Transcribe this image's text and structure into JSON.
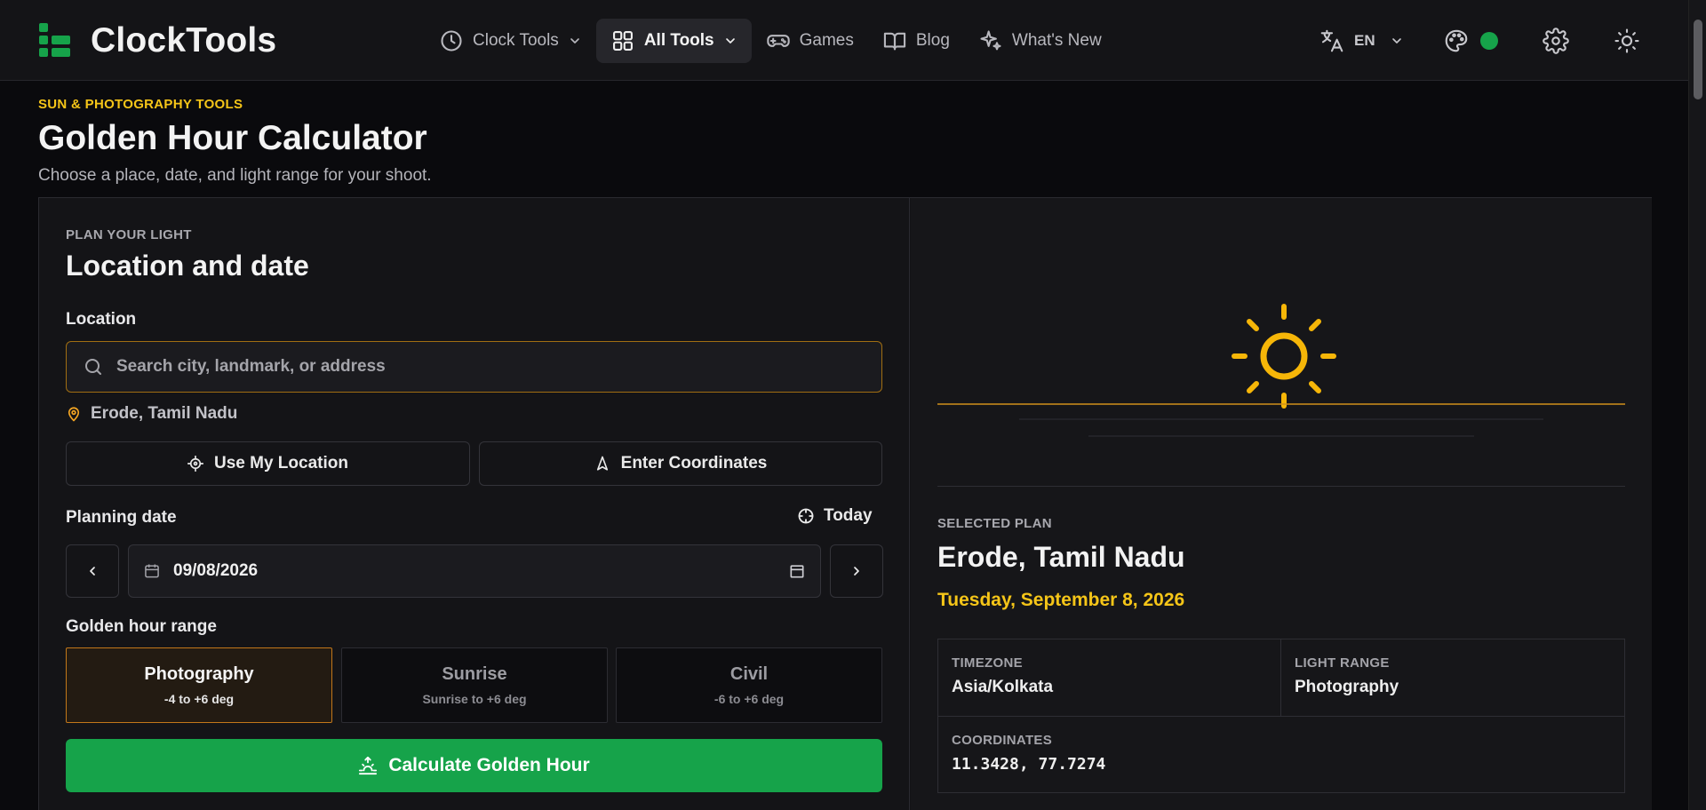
{
  "header": {
    "brand": "ClockTools",
    "nav": [
      {
        "label": "Clock Tools",
        "icon": "clock-icon",
        "dropdown": true
      },
      {
        "label": "All Tools",
        "icon": "grid-icon",
        "dropdown": true,
        "active": true
      },
      {
        "label": "Games",
        "icon": "gamepad-icon"
      },
      {
        "label": "Blog",
        "icon": "book-icon"
      },
      {
        "label": "What's New",
        "icon": "sparkles-icon"
      }
    ],
    "language": "EN",
    "theme_dot_color": "#16a34a"
  },
  "page": {
    "eyebrow": "SUN & PHOTOGRAPHY TOOLS",
    "title": "Golden Hour Calculator",
    "subtitle": "Choose a place, date, and light range for your shoot."
  },
  "form": {
    "eyebrow": "PLAN YOUR LIGHT",
    "title": "Location and date",
    "location_label": "Location",
    "search_placeholder": "Search city, landmark, or address",
    "selected_location": "Erode, Tamil Nadu",
    "use_location_label": "Use My Location",
    "enter_coords_label": "Enter Coordinates",
    "date_label": "Planning date",
    "today_label": "Today",
    "date_value": "09/08/2026",
    "range_label": "Golden hour range",
    "ranges": [
      {
        "name": "Photography",
        "sub": "-4 to +6 deg",
        "active": true
      },
      {
        "name": "Sunrise",
        "sub": "Sunrise to +6 deg",
        "active": false
      },
      {
        "name": "Civil",
        "sub": "-6 to +6 deg",
        "active": false
      }
    ],
    "calculate_label": "Calculate Golden Hour"
  },
  "plan": {
    "eyebrow": "SELECTED PLAN",
    "title": "Erode, Tamil Nadu",
    "date": "Tuesday, September 8, 2026",
    "timezone_label": "TIMEZONE",
    "timezone": "Asia/Kolkata",
    "light_range_label": "LIGHT RANGE",
    "light_range": "Photography",
    "coordinates_label": "COORDINATES",
    "coordinates": "11.3428, 77.7274"
  },
  "colors": {
    "accent_gold": "#f5c518",
    "accent_green": "#16a34a",
    "sun": "#f6b608"
  }
}
